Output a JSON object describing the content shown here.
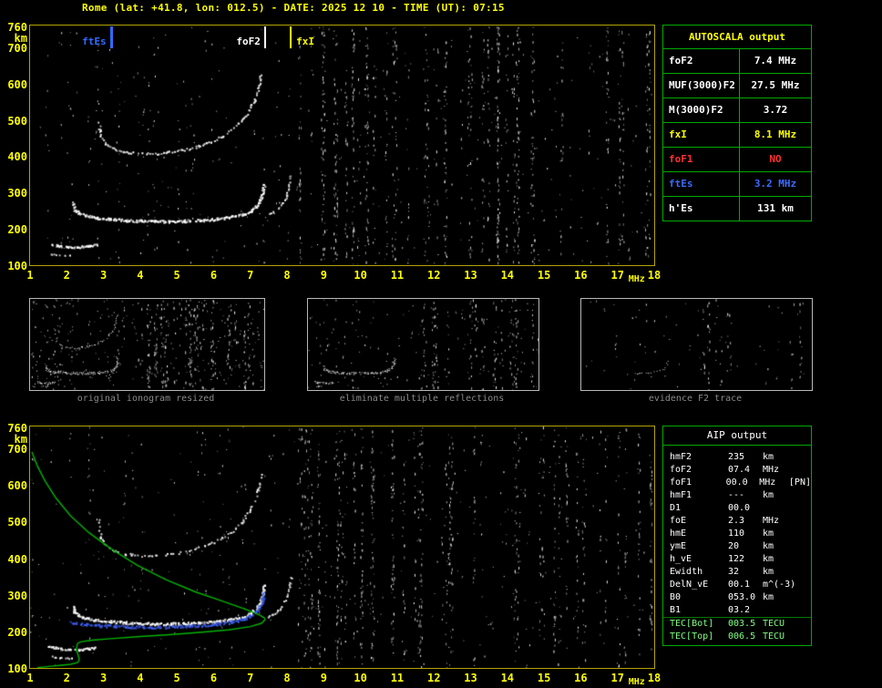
{
  "title": "Rome (lat: +41.8, lon: 012.5) - DATE: 2025 12 10 - TIME (UT): 07:15",
  "colors": {
    "background": "#000000",
    "axis_text": "#ffff00",
    "plot_border": "#b2a400",
    "table_grid": "#00aa00",
    "profile_green": "#00b400",
    "restored_blue": "#3c5ef0",
    "caption_gray": "#8a8a8a"
  },
  "autoscala_table": {
    "title": "AUTOSCALA output",
    "rows": [
      {
        "label": "foF2",
        "value": "7.4",
        "unit": "MHz",
        "color": "#ffffff"
      },
      {
        "label": "MUF(3000)F2",
        "value": "27.5",
        "unit": "MHz",
        "color": "#ffffff"
      },
      {
        "label": "M(3000)F2",
        "value": "3.72",
        "unit": "",
        "color": "#ffffff"
      },
      {
        "label": "fxI",
        "value": "8.1",
        "unit": "MHz",
        "color": "#ffff00"
      },
      {
        "label": "foF1",
        "value": "NO",
        "unit": "",
        "color": "#ff3030"
      },
      {
        "label": "ftEs",
        "value": "3.2",
        "unit": "MHz",
        "color": "#3a6bff"
      },
      {
        "label": "h'Es",
        "value": "131",
        "unit": "km",
        "color": "#ffffff"
      }
    ]
  },
  "aip_table": {
    "title": "AIP output",
    "rows": [
      {
        "param": "hmF2",
        "value": "235",
        "unit": "km",
        "note": ""
      },
      {
        "param": "foF2",
        "value": "07.4",
        "unit": "MHz",
        "note": ""
      },
      {
        "param": "foF1",
        "value": "00.0",
        "unit": "MHz",
        "note": "[PN]"
      },
      {
        "param": "hmF1",
        "value": "---",
        "unit": "km",
        "note": ""
      },
      {
        "param": "D1",
        "value": "00.0",
        "unit": "",
        "note": ""
      },
      {
        "param": "foE",
        "value": "2.3",
        "unit": "MHz",
        "note": ""
      },
      {
        "param": "hmE",
        "value": "110",
        "unit": "km",
        "note": ""
      },
      {
        "param": "ymE",
        "value": "20",
        "unit": "km",
        "note": ""
      },
      {
        "param": "h_vE",
        "value": "122",
        "unit": "km",
        "note": ""
      },
      {
        "param": "Ewidth",
        "value": "32",
        "unit": "km",
        "note": ""
      },
      {
        "param": "DelN_vE",
        "value": "00.1",
        "unit": "m^(-3)",
        "note": ""
      },
      {
        "param": "B0",
        "value": "053.0",
        "unit": "km",
        "note": ""
      },
      {
        "param": "B1",
        "value": "03.2",
        "unit": "",
        "note": ""
      },
      {
        "param": "TEC[Bot]",
        "value": "003.5",
        "unit": "TECU",
        "note": "",
        "color": "#7fff7f",
        "sep": true
      },
      {
        "param": "TEC[Top]",
        "value": "006.5",
        "unit": "TECU",
        "note": "",
        "color": "#7fff7f"
      }
    ]
  },
  "thumbnails": [
    {
      "caption": "original ionogram resized",
      "mode": "full",
      "speckles": 260,
      "stripes": 40
    },
    {
      "caption": "eliminate multiple reflections",
      "mode": "nomult",
      "speckles": 150,
      "stripes": 24
    },
    {
      "caption": "evidence F2 trace",
      "mode": "f2only",
      "speckles": 60,
      "stripes": 10
    }
  ],
  "chart_data": {
    "type": "scatter",
    "title": "ionogram",
    "xlabel": "MHz",
    "ylabel": "km",
    "xlim": [
      1,
      18
    ],
    "ylim": [
      100,
      760
    ],
    "x_ticks": [
      1,
      2,
      3,
      4,
      5,
      6,
      7,
      8,
      9,
      10,
      11,
      12,
      13,
      14,
      15,
      16,
      17,
      18
    ],
    "y_ticks": [
      760,
      700,
      600,
      500,
      400,
      300,
      200,
      100
    ],
    "grid": false,
    "markers": [
      {
        "name": "ftEs",
        "freq": 3.2,
        "color": "#2e6bff",
        "label_side": "left"
      },
      {
        "name": "foF2",
        "freq": 7.4,
        "color": "#ffffff",
        "label_side": "left"
      },
      {
        "name": "fxI",
        "freq": 8.1,
        "color": "#ffff00",
        "label_side": "right"
      }
    ],
    "traces": {
      "es": [
        [
          1.5,
          160
        ],
        [
          1.75,
          155
        ],
        [
          2.0,
          152
        ],
        [
          2.3,
          151
        ],
        [
          2.6,
          154
        ],
        [
          2.8,
          158
        ]
      ],
      "es_low": [
        [
          1.55,
          133
        ],
        [
          1.8,
          129
        ],
        [
          2.1,
          127
        ]
      ],
      "f1hop": [
        [
          2.15,
          272
        ],
        [
          2.2,
          255
        ],
        [
          2.3,
          245
        ],
        [
          2.5,
          238
        ],
        [
          2.8,
          232
        ],
        [
          3.2,
          228
        ],
        [
          3.6,
          225
        ],
        [
          4.0,
          223
        ],
        [
          4.4,
          222
        ],
        [
          4.8,
          222
        ],
        [
          5.2,
          223
        ],
        [
          5.6,
          225
        ],
        [
          6.0,
          228
        ],
        [
          6.4,
          233
        ],
        [
          6.8,
          241
        ],
        [
          7.0,
          250
        ],
        [
          7.15,
          263
        ],
        [
          7.25,
          280
        ],
        [
          7.32,
          302
        ],
        [
          7.37,
          330
        ]
      ],
      "f2hop": [
        [
          2.85,
          505
        ],
        [
          2.88,
          478
        ],
        [
          2.92,
          456
        ],
        [
          3.05,
          436
        ],
        [
          3.25,
          422
        ],
        [
          3.55,
          413
        ],
        [
          3.9,
          409
        ],
        [
          4.3,
          408
        ],
        [
          4.7,
          411
        ],
        [
          5.1,
          417
        ],
        [
          5.5,
          427
        ],
        [
          5.9,
          441
        ],
        [
          6.2,
          456
        ],
        [
          6.5,
          476
        ],
        [
          6.75,
          500
        ],
        [
          6.95,
          527
        ],
        [
          7.1,
          556
        ],
        [
          7.2,
          590
        ],
        [
          7.28,
          628
        ]
      ],
      "xmode": [
        [
          7.45,
          240
        ],
        [
          7.6,
          247
        ],
        [
          7.75,
          258
        ],
        [
          7.88,
          274
        ],
        [
          7.98,
          295
        ],
        [
          8.05,
          322
        ],
        [
          8.1,
          350
        ]
      ]
    },
    "restored_trace": [
      [
        2.1,
        225
      ],
      [
        2.5,
        220
      ],
      [
        2.9,
        217
      ],
      [
        3.3,
        215
      ],
      [
        3.7,
        214
      ],
      [
        4.1,
        213
      ],
      [
        4.5,
        213
      ],
      [
        4.9,
        214
      ],
      [
        5.3,
        216
      ],
      [
        5.7,
        218
      ],
      [
        6.1,
        222
      ],
      [
        6.5,
        227
      ],
      [
        6.8,
        234
      ],
      [
        7.0,
        243
      ],
      [
        7.15,
        255
      ],
      [
        7.25,
        270
      ],
      [
        7.32,
        288
      ],
      [
        7.36,
        305
      ]
    ],
    "profile": [
      [
        1.05,
        690
      ],
      [
        1.2,
        652
      ],
      [
        1.4,
        612
      ],
      [
        1.7,
        565
      ],
      [
        2.1,
        516
      ],
      [
        2.6,
        470
      ],
      [
        3.2,
        426
      ],
      [
        3.9,
        382
      ],
      [
        4.7,
        341
      ],
      [
        5.5,
        308
      ],
      [
        6.2,
        284
      ],
      [
        6.8,
        263
      ],
      [
        7.2,
        247
      ],
      [
        7.38,
        237
      ],
      [
        7.4,
        232
      ],
      [
        7.3,
        222
      ],
      [
        7.0,
        213
      ],
      [
        6.4,
        204
      ],
      [
        5.6,
        197
      ],
      [
        4.8,
        191
      ],
      [
        4.0,
        186
      ],
      [
        3.2,
        180
      ],
      [
        2.7,
        176
      ],
      [
        2.4,
        172
      ],
      [
        2.3,
        168
      ],
      [
        2.27,
        158
      ],
      [
        2.26,
        148
      ],
      [
        2.3,
        138
      ],
      [
        2.33,
        128
      ],
      [
        2.34,
        122
      ],
      [
        2.3,
        115
      ],
      [
        2.1,
        110
      ],
      [
        1.8,
        107
      ],
      [
        1.5,
        104
      ],
      [
        1.2,
        101
      ]
    ],
    "noise": {
      "speckle_count": 340,
      "stripe_count": 58,
      "left_stripe_count": 14,
      "stripe_fmin": 8.2,
      "stripe_fmax": 17.9
    }
  }
}
